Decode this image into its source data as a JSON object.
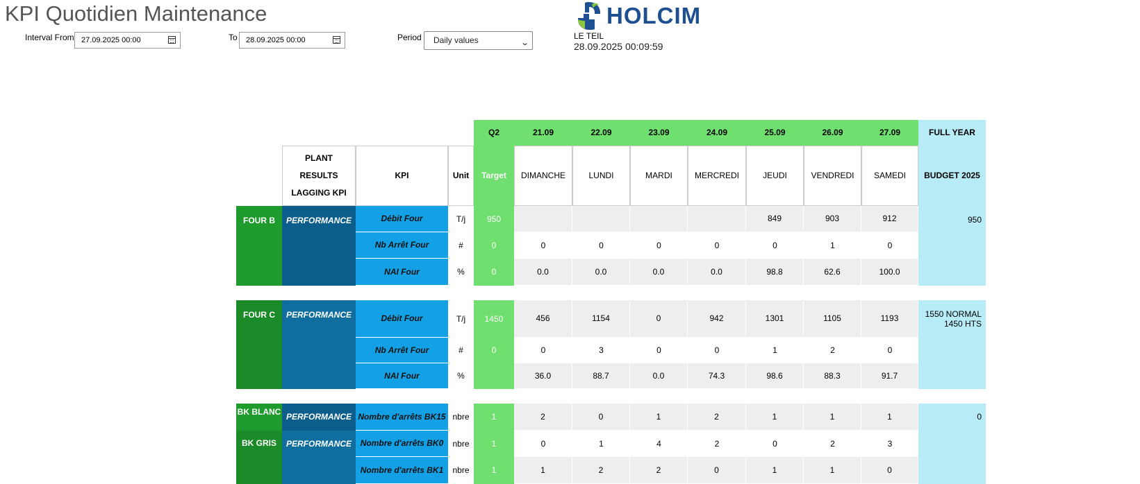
{
  "page": {
    "title": "KPI Quotidien Maintenance"
  },
  "filters": {
    "interval_from_label": "Interval From",
    "interval_from_value": "27.09.2025 00:00",
    "to_label": "To",
    "to_value": "28.09.2025 00:00",
    "period_label": "Period",
    "period_value": "Daily values"
  },
  "brand": {
    "logo_text": "HOLCIM",
    "site": "LE TEIL",
    "timestamp": "28.09.2025 00:09:59",
    "colors": {
      "primary": "#1d4f91",
      "accent": "#8cc63f"
    }
  },
  "colors": {
    "header_green": "#6fe06f",
    "group_green": "#1f9b2e",
    "perf_blue": "#0f6e9e",
    "kpi_blue": "#13a0e5",
    "budget_cyan": "#b7ecf7",
    "cell_gray": "#eeeeee"
  },
  "table": {
    "quarter": "Q2",
    "dates": [
      "21.09",
      "22.09",
      "23.09",
      "24.09",
      "25.09",
      "26.09",
      "27.09"
    ],
    "full_year": "FULL YEAR",
    "plant_results": [
      "PLANT",
      "RESULTS",
      "LAGGING KPI"
    ],
    "kpi_header": "KPI",
    "unit_header": "Unit",
    "target_header": "Target",
    "days": [
      "DIMANCHE",
      "LUNDI",
      "MARDI",
      "MERCREDI",
      "JEUDI",
      "VENDREDI",
      "SAMEDI"
    ],
    "budget_header": "BUDGET 2025",
    "four_b": {
      "name": "FOUR B",
      "category": "PERFORMANCE",
      "budget": "950",
      "rows": [
        {
          "kpi": "Débit Four",
          "unit": "T/j",
          "target": "950",
          "values": [
            "",
            "",
            "",
            "",
            "849",
            "903",
            "912"
          ]
        },
        {
          "kpi": "Nb Arrêt Four",
          "unit": "#",
          "target": "0",
          "values": [
            "0",
            "0",
            "0",
            "0",
            "0",
            "1",
            "0"
          ]
        },
        {
          "kpi": "NAI Four",
          "unit": "%",
          "target": "0",
          "values": [
            "0.0",
            "0.0",
            "0.0",
            "0.0",
            "98.8",
            "62.6",
            "100.0"
          ]
        }
      ]
    },
    "four_c": {
      "name": "FOUR C",
      "category": "PERFORMANCE",
      "budget_line1": "1550 NORMAL",
      "budget_line2": "1450 HTS",
      "rows": [
        {
          "kpi": "Débit Four",
          "unit": "T/j",
          "target": "1450",
          "values": [
            "456",
            "1154",
            "0",
            "942",
            "1301",
            "1105",
            "1193"
          ]
        },
        {
          "kpi": "Nb Arrêt Four",
          "unit": "#",
          "target": "0",
          "values": [
            "0",
            "3",
            "0",
            "0",
            "1",
            "2",
            "0"
          ]
        },
        {
          "kpi": "NAI Four",
          "unit": "%",
          "target": "",
          "values": [
            "36.0",
            "88.7",
            "0.0",
            "74.3",
            "98.6",
            "88.3",
            "91.7"
          ]
        }
      ]
    },
    "bk": {
      "blanc_name": "BK BLANC",
      "gris_name": "BK GRIS",
      "category": "PERFORMANCE",
      "budget": "0",
      "rows": [
        {
          "kpi": "Nombre d'arrêts BK15",
          "unit": "nbre",
          "target": "1",
          "values": [
            "2",
            "0",
            "1",
            "2",
            "1",
            "1",
            "1"
          ]
        },
        {
          "kpi": "Nombre d'arrêts BK0",
          "unit": "nbre",
          "target": "1",
          "values": [
            "0",
            "1",
            "4",
            "2",
            "0",
            "2",
            "3"
          ]
        },
        {
          "kpi": "Nombre d'arrêts BK1",
          "unit": "nbre",
          "target": "1",
          "values": [
            "1",
            "2",
            "2",
            "0",
            "1",
            "1",
            "0"
          ]
        }
      ]
    }
  }
}
